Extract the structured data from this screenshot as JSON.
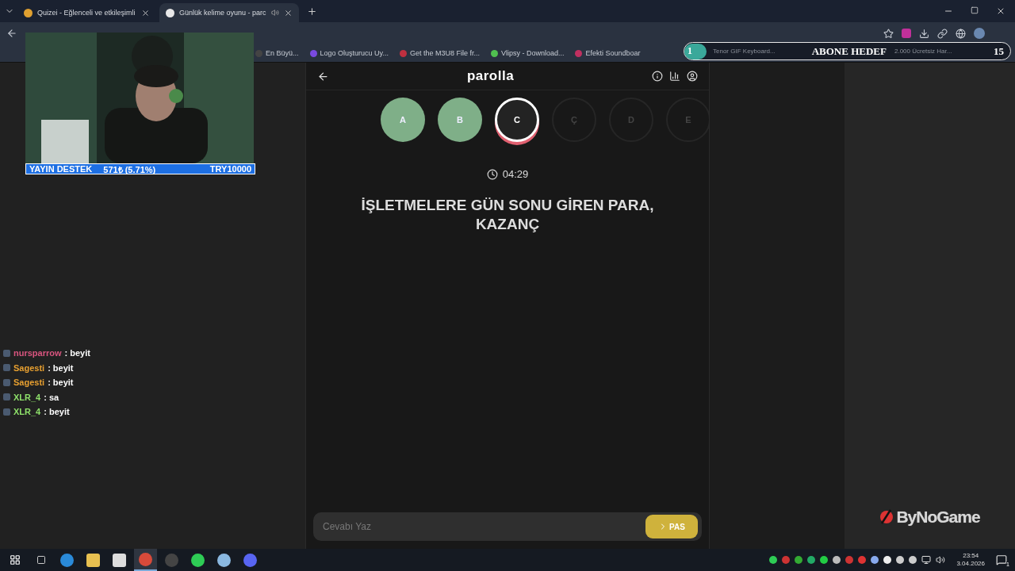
{
  "browser": {
    "tabs": [
      {
        "title": "Quizei - Eğlenceli ve etkileşimli",
        "selected": false
      },
      {
        "title": "Günlük kelime oyunu - parc",
        "selected": true
      }
    ],
    "bookmarks": [
      "En Büyü...",
      "Logo Oluşturucu Uy...",
      "Get the M3U8 File fr...",
      "Vlipsy - Download...",
      "Efekti Soundboar"
    ]
  },
  "overlays": {
    "goal_bar": {
      "current": "1",
      "bookmark_left": "Tenor GIF Keyboard...",
      "title": "ABONE HEDEF",
      "bookmark_right": "2.000 Ücretsiz Har...",
      "target": "15"
    },
    "donation_bar": {
      "label": "YAYIN DESTEK",
      "amount": "571₺ (5.71%)",
      "goal": "TRY10000"
    },
    "chat": [
      {
        "user": "nursparrow",
        "message": ": beyit",
        "color": "#d9557f"
      },
      {
        "user": "Sagesti",
        "message": ": beyit",
        "color": "#e8a030"
      },
      {
        "user": "Sagesti",
        "message": ": beyit",
        "color": "#e8a030"
      },
      {
        "user": "XLR_4",
        "message": ": sa",
        "color": "#8ee06a"
      },
      {
        "user": "XLR_4",
        "message": ": beyit",
        "color": "#8ee06a"
      }
    ],
    "logo": "ByNoGame"
  },
  "game": {
    "title": "parolla",
    "letters": [
      {
        "letter": "A",
        "answered": true,
        "selected": false
      },
      {
        "letter": "B",
        "answered": true,
        "selected": false
      },
      {
        "letter": "C",
        "answered": false,
        "selected": true
      },
      {
        "letter": "Ç",
        "answered": false,
        "selected": false
      },
      {
        "letter": "D",
        "answered": false,
        "selected": false
      },
      {
        "letter": "E",
        "answered": false,
        "selected": false
      }
    ],
    "timer": "04:29",
    "question": "İŞLETMELERE GÜN SONU GİREN PARA, KAZANÇ",
    "answer": {
      "placeholder": "Cevabı Yaz"
    },
    "pass_button": "PAS"
  },
  "taskbar": {
    "time": "23:54",
    "date": "3.04.2026",
    "notifications": "1"
  }
}
